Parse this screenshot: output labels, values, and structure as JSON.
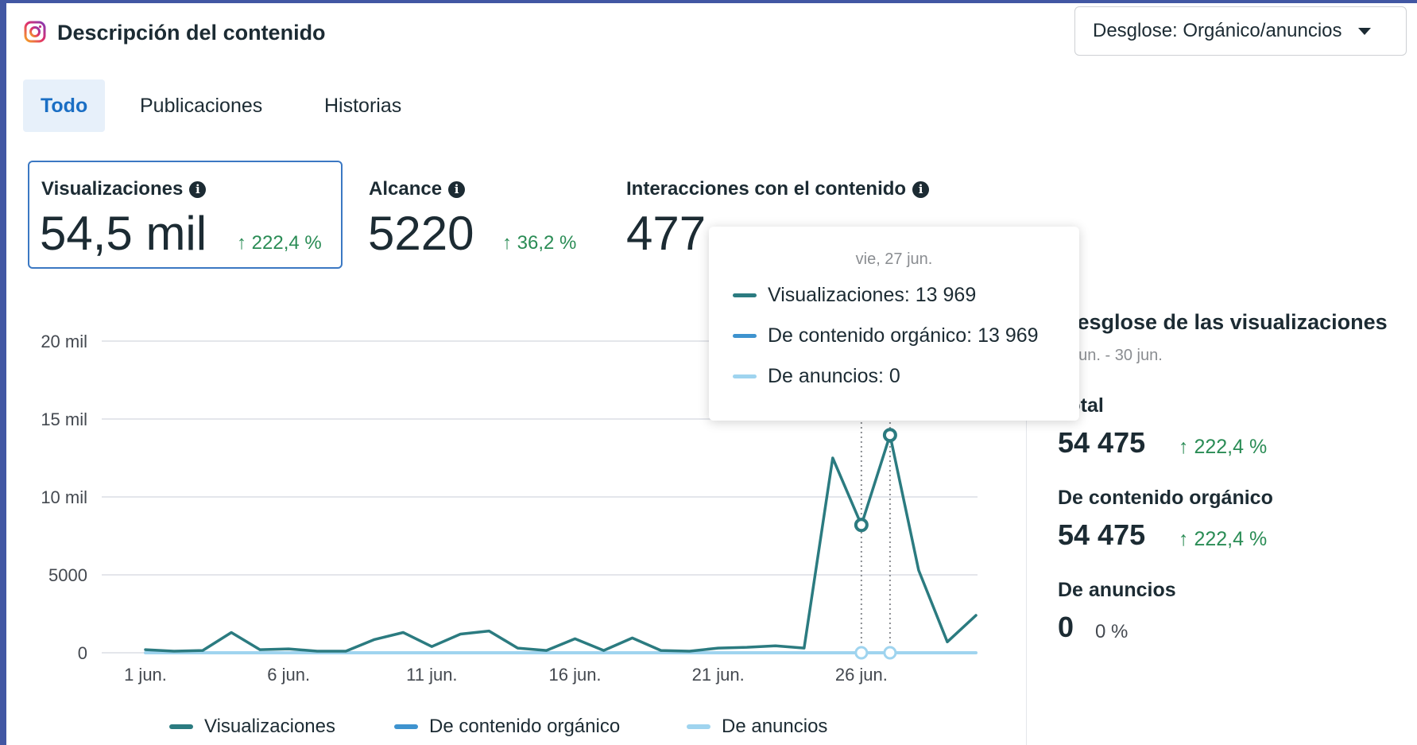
{
  "header": {
    "title": "Descripción del contenido",
    "breakdown_label": "Desglose: Orgánico/anuncios"
  },
  "tabs": [
    "Todo",
    "Publicaciones",
    "Historias"
  ],
  "metrics": [
    {
      "label": "Visualizaciones",
      "value": "54,5 mil",
      "change": "↑ 222,4 %"
    },
    {
      "label": "Alcance",
      "value": "5220",
      "change": "↑ 36,2 %"
    },
    {
      "label": "Interacciones con el contenido",
      "value": "477"
    }
  ],
  "tooltip": {
    "date": "vie, 27 jun.",
    "rows": [
      "Visualizaciones: 13 969",
      "De contenido orgánico: 13 969",
      "De anuncios: 0"
    ]
  },
  "breakdown_panel": {
    "title": "Desglose de las visualizaciones",
    "date_range": "1 jun. - 30 jun.",
    "total_label": "Total",
    "total_value": "54 475",
    "total_change": "↑ 222,4 %",
    "organic_label": "De contenido orgánico",
    "organic_value": "54 475",
    "organic_change": "↑ 222,4 %",
    "ads_label": "De anuncios",
    "ads_value": "0",
    "ads_change": "0 %"
  },
  "colors": {
    "views": "#2b7b80",
    "organic": "#3e93cf",
    "ads": "#9fd4ef",
    "positive": "#2a8c55",
    "active_tab": "#1a6ec4"
  },
  "chart_data": {
    "type": "line",
    "x": [
      "1 jun.",
      "2 jun.",
      "3 jun.",
      "4 jun.",
      "5 jun.",
      "6 jun.",
      "7 jun.",
      "8 jun.",
      "9 jun.",
      "10 jun.",
      "11 jun.",
      "12 jun.",
      "13 jun.",
      "14 jun.",
      "15 jun.",
      "16 jun.",
      "17 jun.",
      "18 jun.",
      "19 jun.",
      "20 jun.",
      "21 jun.",
      "22 jun.",
      "23 jun.",
      "24 jun.",
      "25 jun.",
      "26 jun.",
      "27 jun.",
      "28 jun.",
      "29 jun.",
      "30 jun."
    ],
    "x_tick_labels": [
      "1 jun.",
      "6 jun.",
      "11 jun.",
      "16 jun.",
      "21 jun.",
      "26 jun."
    ],
    "y_tick_labels": [
      "20 mil",
      "15 mil",
      "10 mil",
      "5000",
      "0"
    ],
    "y_ticks": [
      20000,
      15000,
      10000,
      5000,
      0
    ],
    "ylim": [
      0,
      20000
    ],
    "series": [
      {
        "name": "Visualizaciones",
        "values": [
          200,
          100,
          150,
          1300,
          200,
          250,
          100,
          100,
          850,
          1300,
          400,
          1200,
          1400,
          300,
          150,
          900,
          150,
          950,
          150,
          100,
          300,
          350,
          450,
          300,
          12500,
          8200,
          13969,
          5300,
          700,
          2400
        ]
      },
      {
        "name": "De contenido orgánico",
        "values": [
          200,
          100,
          150,
          1300,
          200,
          250,
          100,
          100,
          850,
          1300,
          400,
          1200,
          1400,
          300,
          150,
          900,
          150,
          950,
          150,
          100,
          300,
          350,
          450,
          300,
          12500,
          8200,
          13969,
          5300,
          700,
          2400
        ]
      },
      {
        "name": "De anuncios",
        "values": [
          0,
          0,
          0,
          0,
          0,
          0,
          0,
          0,
          0,
          0,
          0,
          0,
          0,
          0,
          0,
          0,
          0,
          0,
          0,
          0,
          0,
          0,
          0,
          0,
          0,
          0,
          0,
          0,
          0,
          0
        ]
      }
    ],
    "highlighted": [
      "26 jun.",
      "27 jun."
    ],
    "legend": [
      "Visualizaciones",
      "De contenido orgánico",
      "De anuncios"
    ],
    "legend_position": "bottom",
    "grid": true
  }
}
